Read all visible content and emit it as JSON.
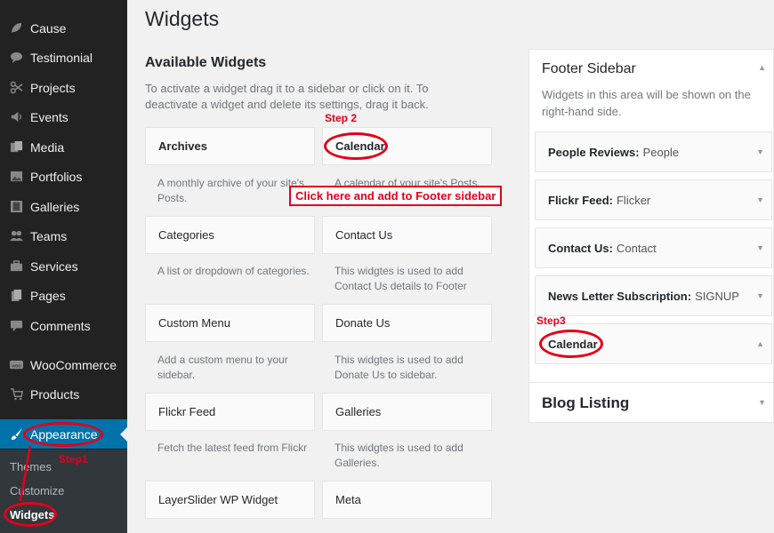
{
  "sidebar": {
    "items": [
      {
        "label": "Cause",
        "icon": "leaf-icon"
      },
      {
        "label": "Testimonial",
        "icon": "speech-bubble-icon"
      },
      {
        "label": "Projects",
        "icon": "scissors-icon"
      },
      {
        "label": "Events",
        "icon": "megaphone-icon"
      },
      {
        "label": "Media",
        "icon": "media-icon"
      },
      {
        "label": "Portfolios",
        "icon": "image-icon"
      },
      {
        "label": "Galleries",
        "icon": "film-icon"
      },
      {
        "label": "Teams",
        "icon": "group-icon"
      },
      {
        "label": "Services",
        "icon": "briefcase-icon"
      },
      {
        "label": "Pages",
        "icon": "pages-icon"
      },
      {
        "label": "Comments",
        "icon": "comment-icon"
      },
      {
        "label": "WooCommerce",
        "icon": "woo-icon"
      },
      {
        "label": "Products",
        "icon": "cart-icon"
      },
      {
        "label": "Appearance",
        "icon": "brush-icon"
      }
    ],
    "submenu": [
      "Themes",
      "Customize",
      "Widgets"
    ],
    "active_color": "#0073aa"
  },
  "main": {
    "title": "Widgets",
    "available_title": "Available Widgets",
    "available_desc": "To activate a widget drag it to a sidebar or click on it. To deactivate a widget and delete its settings, drag it back.",
    "widgets": [
      {
        "name": "Archives",
        "desc": "A monthly archive of your site's Posts."
      },
      {
        "name": "Calendar",
        "desc": "A calendar of your site's Posts."
      },
      {
        "name": "Categories",
        "desc": "A list or dropdown of categories."
      },
      {
        "name": "Contact Us",
        "desc": "This widgtes is used to add Contact Us details to Footer"
      },
      {
        "name": "Custom Menu",
        "desc": "Add a custom menu to your sidebar."
      },
      {
        "name": "Donate Us",
        "desc": "This widgtes is used to add Donate Us to sidebar."
      },
      {
        "name": "Flickr Feed",
        "desc": "Fetch the latest feed from Flickr"
      },
      {
        "name": "Galleries",
        "desc": "This widgtes is used to add Galleries."
      },
      {
        "name": "LayerSlider WP Widget",
        "desc": ""
      },
      {
        "name": "Meta",
        "desc": ""
      }
    ]
  },
  "footer_sidebar": {
    "title": "Footer Sidebar",
    "desc": "Widgets in this area will be shown on the right-hand side.",
    "widgets": [
      {
        "name": "People Reviews",
        "sub": "People"
      },
      {
        "name": "Flickr Feed",
        "sub": "Flicker"
      },
      {
        "name": "Contact Us",
        "sub": "Contact"
      },
      {
        "name": "News Letter Subscription",
        "sub": "SIGNUP"
      },
      {
        "name": "Calendar",
        "sub": ""
      }
    ]
  },
  "blog_listing": {
    "title": "Blog Listing"
  },
  "annotations": {
    "step1": "Step1",
    "step2": "Step 2",
    "step3": "Step3",
    "callout": "Click here and add to Footer sidebar",
    "color": "#e2001a"
  }
}
